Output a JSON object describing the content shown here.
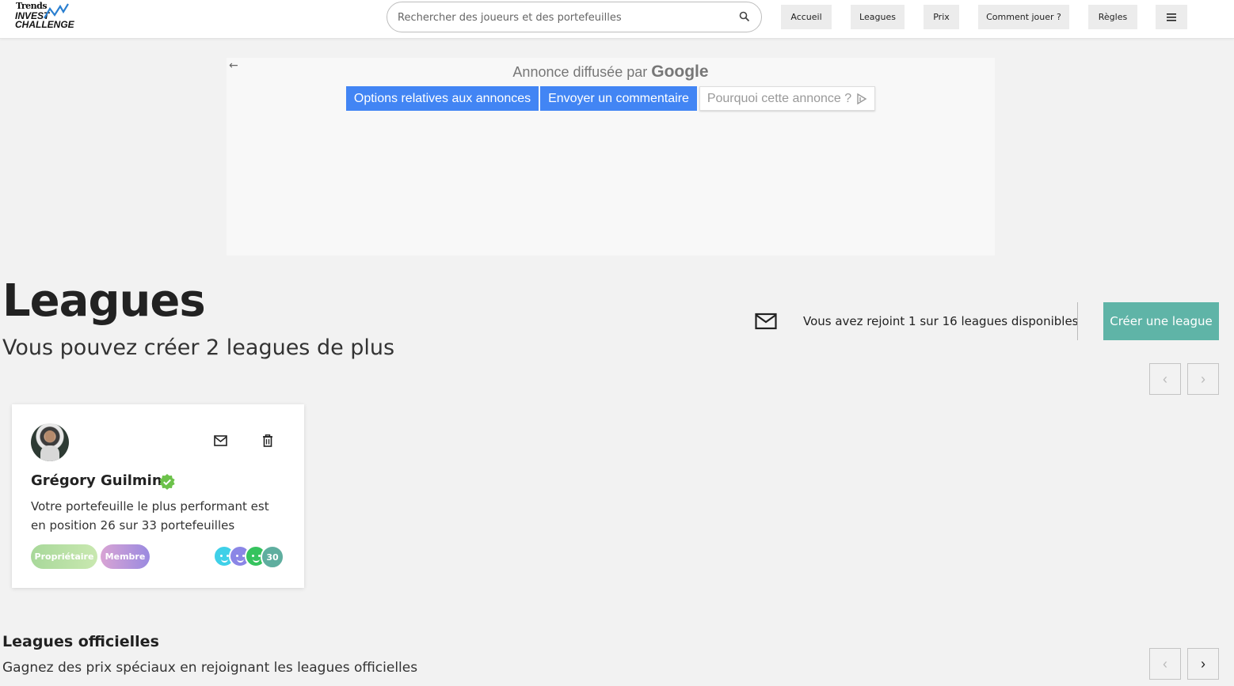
{
  "header": {
    "logo": {
      "line1": "Trends",
      "line2": "INVEST",
      "line3": "CHALLENGE"
    },
    "search": {
      "placeholder": "Rechercher des joueurs et des portefeuilles"
    },
    "nav": [
      {
        "label": "Accueil"
      },
      {
        "label": "Leagues"
      },
      {
        "label": "Prix"
      },
      {
        "label": "Comment jouer ?"
      },
      {
        "label": "Règles"
      }
    ],
    "menu_icon": "hamburger-menu-icon"
  },
  "ad": {
    "back_icon": "arrow-left-icon",
    "served_by": "Annonce diffusée par",
    "brand": "Google",
    "options_label": "Options relatives aux annonces",
    "feedback_label": "Envoyer un commentaire",
    "why_label": "Pourquoi cette annonce ?",
    "why_icon": "adchoices-icon"
  },
  "leagues": {
    "title": "Leagues",
    "subtitle": "Vous pouvez créer 2 leagues de plus",
    "joined_text": "Vous avez rejoint 1 sur 16 leagues disponibles",
    "create_label": "Créer une league",
    "prev_glyph": "‹",
    "next_glyph": "›",
    "card": {
      "name": "Grégory Guilmin",
      "description": "Votre portefeuille le plus performant est en position 26 sur 33 portefeuilles",
      "tags": [
        "Propriétaire",
        "Membre"
      ],
      "member_count": "30"
    }
  },
  "official": {
    "title": "Leagues officielles",
    "subtitle": "Gagnez des prix spéciaux en rejoignant les leagues officielles",
    "prev_glyph": "‹",
    "next_glyph": "›"
  },
  "colors": {
    "accent": "#5fb4a7",
    "google_blue": "#4285f4",
    "verified_green": "#6cc24a"
  }
}
